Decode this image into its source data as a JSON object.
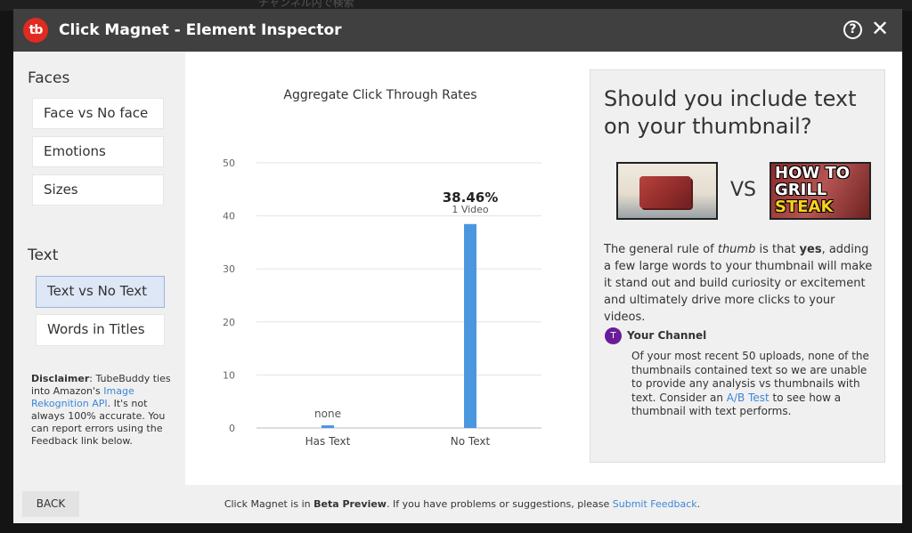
{
  "background": {
    "search_hint": "チャンネル内で検索"
  },
  "window": {
    "logo_text": "tb",
    "title": "Click Magnet - Element Inspector",
    "help_icon": "question-circle-icon",
    "close_icon": "close-icon"
  },
  "sidebar": {
    "faces_title": "Faces",
    "faces_items": [
      "Face vs No face",
      "Emotions",
      "Sizes"
    ],
    "text_title": "Text",
    "text_items": [
      "Text vs No Text",
      "Words in Titles"
    ],
    "disclaimer": {
      "label": "Disclaimer",
      "text1": ": TubeBuddy ties into Amazon's ",
      "link": "Image Rekognition API",
      "text2": ". It's not always 100% accurate. You can report errors using the Feedback link below."
    }
  },
  "chart_data": {
    "type": "bar",
    "title": "Aggregate Click Through Rates",
    "categories": [
      "Has Text",
      "No Text"
    ],
    "values": [
      0.5,
      38.46
    ],
    "value_labels": [
      "none",
      "38.46%"
    ],
    "sub_labels": [
      "",
      "1 Video"
    ],
    "ylim": [
      0,
      50
    ],
    "yticks": [
      0,
      10,
      20,
      30,
      40,
      50
    ],
    "grid": true,
    "bar_color": "#4a97e0"
  },
  "info": {
    "heading": "Should you include text on your thumbnail?",
    "vs": "VS",
    "thumb2_lines": [
      "HOW TO",
      "GRILL",
      "STEAK"
    ],
    "body": {
      "t1": "The general rule of ",
      "em": "thumb",
      "t2": " is that ",
      "strong": "yes",
      "t3": ", adding a few large words to your thumbnail will make it stand out and build curiosity or excitement and ultimately drive more clicks to your videos."
    },
    "channel": {
      "avatar": "T",
      "avatar_color": "#6a1b9a",
      "name": "Your Channel",
      "text1": "Of your most recent 50 uploads, none of the thumbnails contained text so we are unable to provide any analysis vs thumbnails with text. Consider an ",
      "link": "A/B Test",
      "text2": " to see how a thumbnail with text performs."
    }
  },
  "footer": {
    "back_label": "BACK",
    "text1": "Click Magnet is in ",
    "bold": "Beta Preview",
    "text2": ". If you have problems or suggestions, please ",
    "link": "Submit Feedback",
    "text3": "."
  }
}
